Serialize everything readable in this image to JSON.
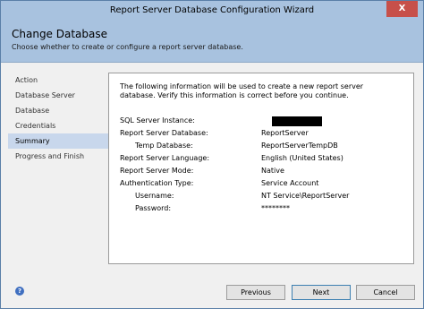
{
  "window": {
    "title": "Report Server Database Configuration Wizard",
    "close_glyph": "X"
  },
  "header": {
    "title": "Change Database",
    "subtitle": "Choose whether to create or configure a report server database."
  },
  "sidebar": {
    "items": [
      {
        "label": "Action"
      },
      {
        "label": "Database Server"
      },
      {
        "label": "Database"
      },
      {
        "label": "Credentials"
      },
      {
        "label": "Summary",
        "active": true
      },
      {
        "label": "Progress and Finish"
      }
    ]
  },
  "summary": {
    "intro": "The following information will be used to create a new report server database. Verify this information is correct before you continue.",
    "rows": [
      {
        "label": "SQL Server Instance:",
        "value": ""
      },
      {
        "label": "Report Server Database:",
        "value": "ReportServer"
      },
      {
        "label": "Temp Database:",
        "value": "ReportServerTempDB"
      },
      {
        "label": "Report Server Language:",
        "value": "English (United States)"
      },
      {
        "label": "Report Server Mode:",
        "value": "Native"
      },
      {
        "label": "Authentication Type:",
        "value": "Service Account"
      },
      {
        "label": "Username:",
        "value": "NT Service\\ReportServer"
      },
      {
        "label": "Password:",
        "value": "********"
      }
    ]
  },
  "footer": {
    "previous_label": "Previous",
    "next_label": "Next",
    "cancel_label": "Cancel",
    "help_glyph": "?"
  },
  "colors": {
    "chrome": "#a8c2df",
    "active_nav": "#c8d7ec",
    "close": "#c7504a"
  }
}
